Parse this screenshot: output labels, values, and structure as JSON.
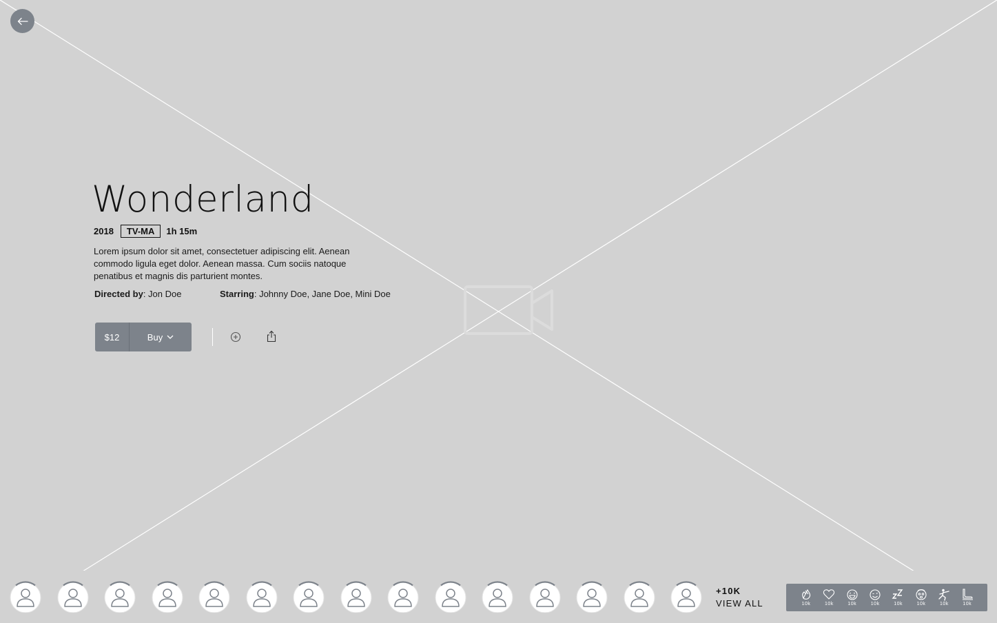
{
  "colors": {
    "background": "#d2d2d2",
    "control": "#7d838b",
    "text": "#111111"
  },
  "nav": {
    "back_icon": "arrow-left-icon"
  },
  "hero": {
    "placeholder_icon": "video-camera-icon"
  },
  "movie": {
    "title": "Wonderland",
    "year": "2018",
    "rating": "TV-MA",
    "duration": "1h 15m",
    "description": "Lorem ipsum dolor sit amet, consectetuer adipiscing elit. Aenean commodo ligula eget dolor. Aenean massa. Cum sociis natoque penatibus et magnis dis parturient montes.",
    "directed_by_label": "Directed by",
    "director": ": Jon Doe",
    "starring_label": "Starring",
    "cast": ": Johnny Doe, Jane Doe, Mini Doe"
  },
  "actions": {
    "price": "$12",
    "buy_label": "Buy",
    "add_icon": "plus-circle-icon",
    "share_icon": "share-icon"
  },
  "viewers": {
    "avatar_count": 15,
    "avatar_icon": "user-icon",
    "more_count": "+10K",
    "view_all_label": "VIEW ALL"
  },
  "reactions": [
    {
      "icon": "clap-icon",
      "count": "10k"
    },
    {
      "icon": "heart-icon",
      "count": "10k"
    },
    {
      "icon": "laugh-icon",
      "count": "10k"
    },
    {
      "icon": "wink-icon",
      "count": "10k"
    },
    {
      "icon": "sleep-icon",
      "count": "10k"
    },
    {
      "icon": "scared-icon",
      "count": "10k"
    },
    {
      "icon": "kick-icon",
      "count": "10k"
    },
    {
      "icon": "skate-icon",
      "count": "10k"
    }
  ]
}
